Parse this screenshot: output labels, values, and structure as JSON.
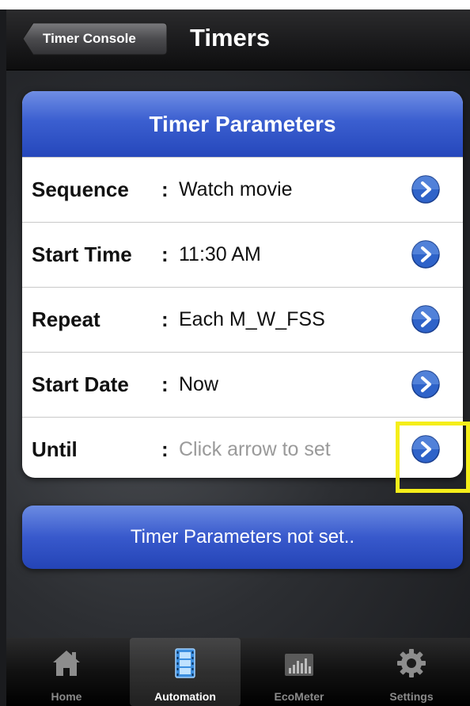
{
  "navbar": {
    "back_label": "Timer Console",
    "title": "Timers"
  },
  "card": {
    "header": "Timer Parameters",
    "rows": [
      {
        "label": "Sequence",
        "separator": ":",
        "value": "Watch movie"
      },
      {
        "label": "Start Time",
        "separator": ":",
        "value": "11:30 AM"
      },
      {
        "label": "Repeat",
        "separator": ":",
        "value": "Each M_W_FSS"
      },
      {
        "label": "Start Date",
        "separator": ":",
        "value": "Now"
      },
      {
        "label": "Until",
        "separator": ":",
        "value": "Click arrow to set"
      }
    ]
  },
  "status": {
    "text": "Timer Parameters not set.."
  },
  "tabbar": {
    "tabs": [
      {
        "label": "Home",
        "icon": "home-icon",
        "active": false
      },
      {
        "label": "Automation",
        "icon": "film-icon",
        "active": true
      },
      {
        "label": "EcoMeter",
        "icon": "meter-icon",
        "active": false
      },
      {
        "label": "Settings",
        "icon": "gear-icon",
        "active": false
      }
    ]
  },
  "colors": {
    "accent_blue": "#3b5fd0",
    "highlight": "#f5ee1a"
  }
}
